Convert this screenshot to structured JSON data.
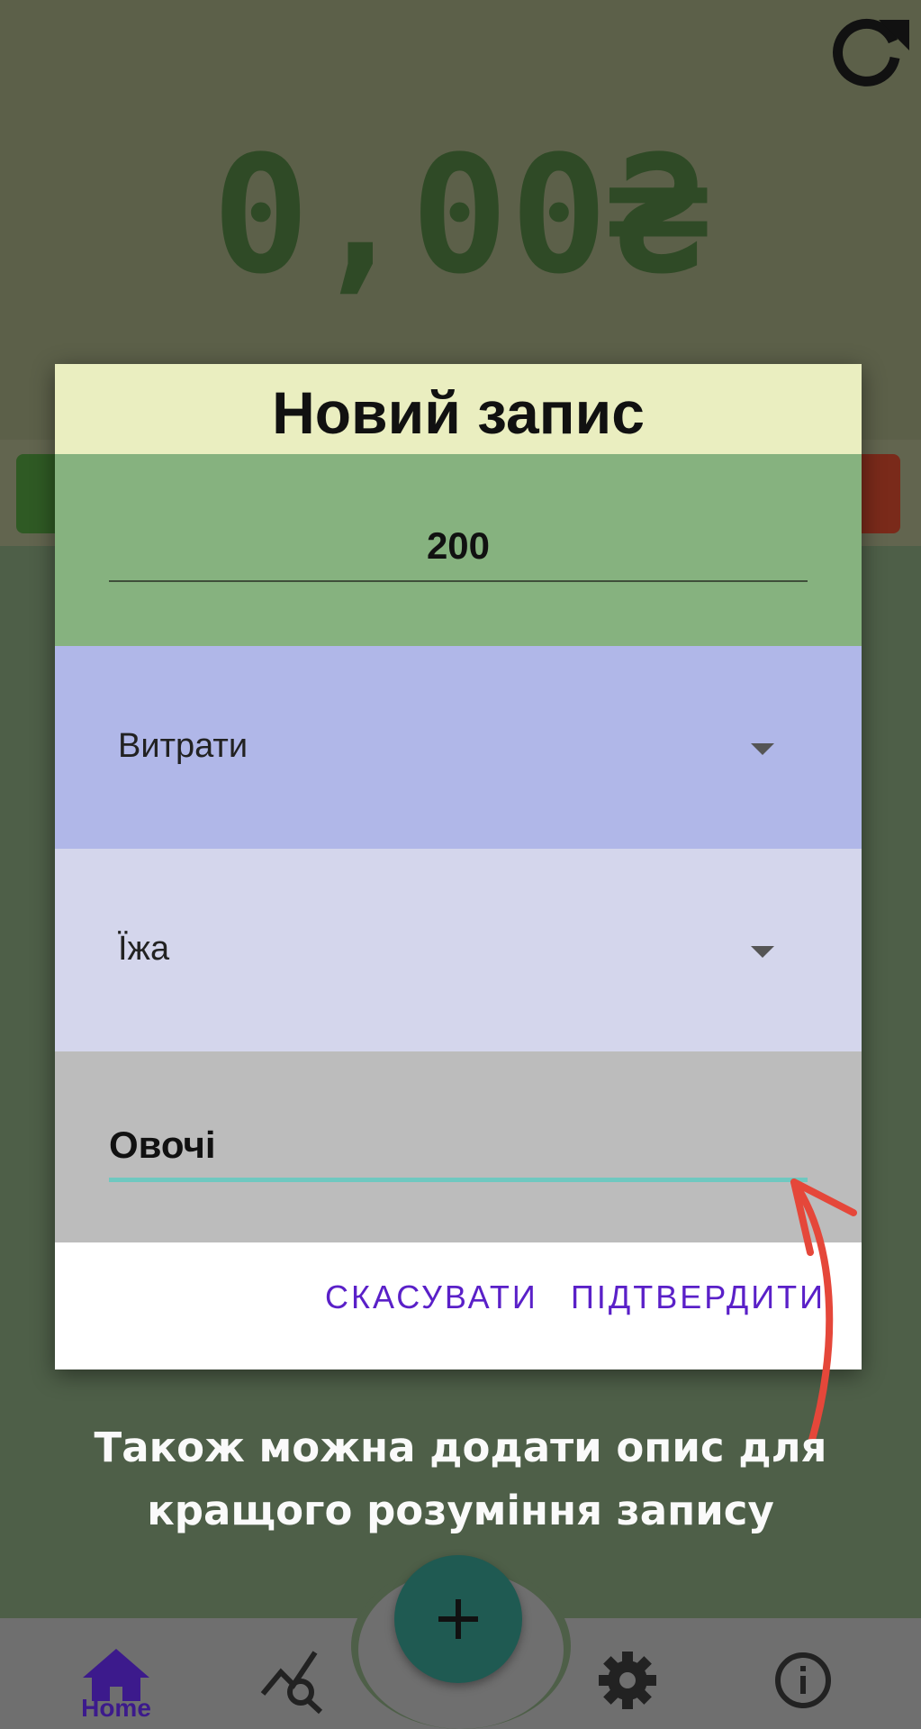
{
  "balance": "0,00₴",
  "dialog": {
    "title": "Новий запис",
    "amount": "200",
    "type": "Витрати",
    "category": "Їжа",
    "description": "Овочі",
    "cancel_label": "СКАСУВАТИ",
    "confirm_label": "ПІДТВЕРДИТИ"
  },
  "hint": {
    "line1": "Також можна додати опис для",
    "line2": "кращого розуміння запису"
  },
  "nav": {
    "home_label": "Home",
    "icons": [
      "home-icon",
      "stats-icon",
      "add-icon",
      "settings-icon",
      "info-icon"
    ]
  },
  "colors": {
    "accent": "#5a20c8",
    "fab": "#1f5a52",
    "balance": "#2f4a26",
    "arrow": "#e5473a",
    "desc_underline": "#6fc8c0"
  }
}
